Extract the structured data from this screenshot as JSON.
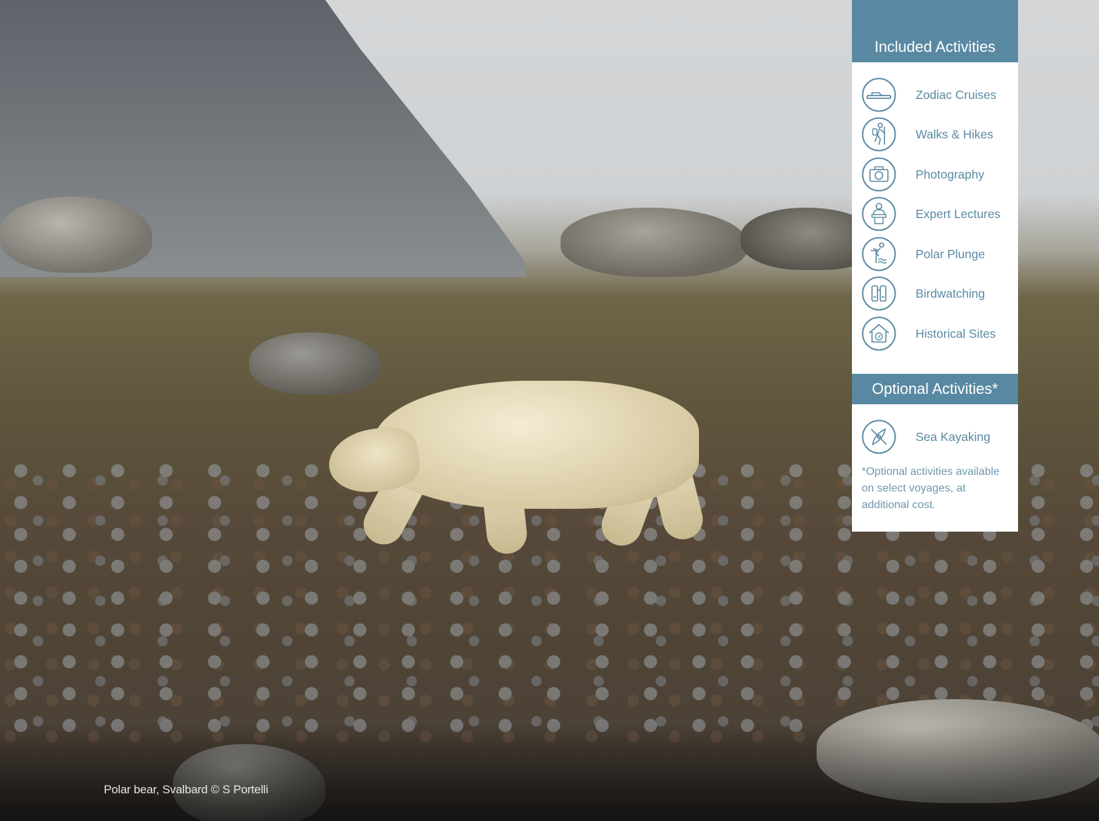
{
  "photo": {
    "caption": "Polar bear, Svalbard © S Portelli"
  },
  "panel": {
    "included_title": "Included Activities",
    "included": [
      {
        "label": "Zodiac Cruises",
        "icon": "zodiac-boat-icon"
      },
      {
        "label": "Walks & Hikes",
        "icon": "hiker-icon"
      },
      {
        "label": "Photography",
        "icon": "camera-icon"
      },
      {
        "label": "Expert Lectures",
        "icon": "lecturer-icon"
      },
      {
        "label": "Polar Plunge",
        "icon": "swimmer-icon"
      },
      {
        "label": "Birdwatching",
        "icon": "binoculars-icon"
      },
      {
        "label": "Historical Sites",
        "icon": "historic-house-icon"
      }
    ],
    "optional_title": "Optional Activities*",
    "optional": [
      {
        "label": "Sea Kayaking",
        "icon": "kayak-icon"
      }
    ],
    "note": "*Optional activities available on select voyages, at additional cost."
  },
  "colors": {
    "accent": "#5989a2",
    "label_text": "#5a8aa3"
  }
}
